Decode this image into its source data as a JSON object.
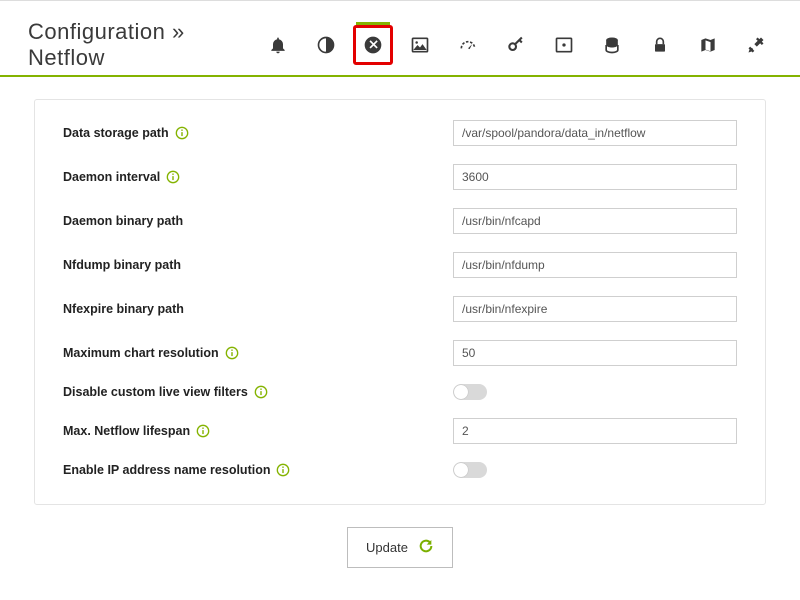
{
  "header": {
    "title": "Configuration » Netflow"
  },
  "toolbar": {
    "icons": [
      "bell-icon",
      "contrast-icon",
      "netflow-icon",
      "image-icon",
      "gauge-icon",
      "key-icon",
      "monitor-icon",
      "stack-icon",
      "lock-icon",
      "map-icon",
      "tools-icon"
    ],
    "highlighted": "netflow-icon"
  },
  "form": {
    "rows": [
      {
        "label": "Data storage path",
        "info": true,
        "type": "text",
        "value": "/var/spool/pandora/data_in/netflow"
      },
      {
        "label": "Daemon interval",
        "info": true,
        "type": "text",
        "value": "3600"
      },
      {
        "label": "Daemon binary path",
        "info": false,
        "type": "text",
        "value": "/usr/bin/nfcapd"
      },
      {
        "label": "Nfdump binary path",
        "info": false,
        "type": "text",
        "value": "/usr/bin/nfdump"
      },
      {
        "label": "Nfexpire binary path",
        "info": false,
        "type": "text",
        "value": "/usr/bin/nfexpire"
      },
      {
        "label": "Maximum chart resolution",
        "info": true,
        "type": "text",
        "value": "50"
      },
      {
        "label": "Disable custom live view filters",
        "info": true,
        "type": "toggle",
        "value": "off"
      },
      {
        "label": "Max. Netflow lifespan",
        "info": true,
        "type": "text",
        "value": "2"
      },
      {
        "label": "Enable IP address name resolution",
        "info": true,
        "type": "toggle",
        "value": "off"
      }
    ]
  },
  "actions": {
    "update_label": "Update"
  }
}
